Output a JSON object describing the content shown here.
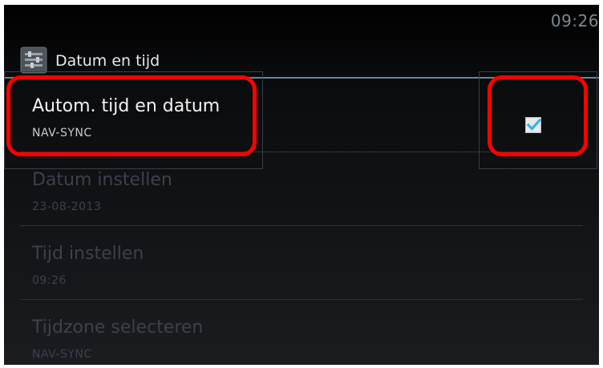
{
  "status_bar": {
    "time": "09:26"
  },
  "action_bar": {
    "title": "Datum en tijd",
    "icon": "settings-app-icon"
  },
  "settings": [
    {
      "title": "Autom. tijd en datum",
      "subtitle": "NAV-SYNC",
      "checked": true,
      "enabled": true
    },
    {
      "title": "Datum instellen",
      "subtitle": "23-08-2013",
      "enabled": false
    },
    {
      "title": "Tijd instellen",
      "subtitle": "09:26",
      "enabled": false
    },
    {
      "title": "Tijdzone selecteren",
      "subtitle": "NAV-SYNC",
      "enabled": false
    }
  ],
  "colors": {
    "accent": "#33b5e5",
    "highlight": "#ff0000"
  }
}
